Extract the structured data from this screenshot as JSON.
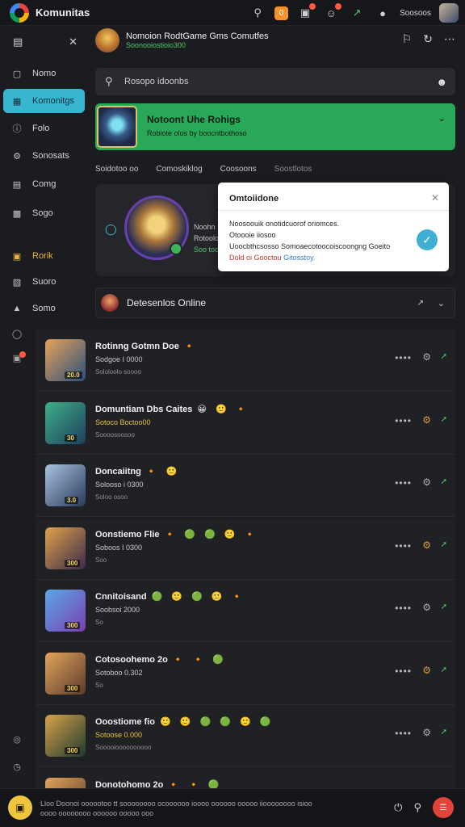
{
  "app": {
    "title": "Komunitas"
  },
  "topbar": {
    "icons": [
      "search-icon",
      "notification-icon",
      "gift-icon",
      "emoji-icon",
      "activity-icon"
    ],
    "notification_count": "0",
    "user_name": "Soosoos"
  },
  "sidebar": {
    "header_icon": "layout-icon",
    "close_icon": "close-icon",
    "items": [
      {
        "label": "Nomo",
        "icon": "monitor-icon"
      },
      {
        "label": "Komonitgs",
        "icon": "bookmark-icon"
      },
      {
        "label": "Folo",
        "icon": "info-icon"
      },
      {
        "label": "Sonosats",
        "icon": "settings-icon"
      },
      {
        "label": "Comg",
        "icon": "document-icon"
      },
      {
        "label": "Sogo",
        "icon": "image-icon"
      },
      {
        "label": "Rorik",
        "icon": "calendar-icon"
      },
      {
        "label": "Suoro",
        "icon": "share-icon"
      },
      {
        "label": "Somo",
        "icon": "user-icon"
      }
    ]
  },
  "channel": {
    "title": "Nomoion RodtGame Gms Comutfes",
    "subtitle": "Soonooiostioio300"
  },
  "search": {
    "placeholder": "Rosopo idoonbs"
  },
  "banner": {
    "title": "Notoont Uhe Rohigs",
    "subtitle": "Robiote olos by boocntbothoso"
  },
  "tabs": [
    "Soidotoo oo",
    "Comoskiklog",
    "Coosoons",
    "Soostlotos"
  ],
  "feature": {
    "lines": [
      "Noohn",
      "Rotoolo",
      "Soo too"
    ]
  },
  "popup": {
    "title": "Omtoiidone",
    "line1": "Noosoouik onotidcuorof oriomces.",
    "line2": "Otoooie iiosoo",
    "line3": "Uoocbthcsosso Somoaecotoocoiscoongng Goeito",
    "line4_red": "Dold oi Gooctou",
    "line4_blue": "Gitosstoy."
  },
  "online": {
    "title": "Detesenlos Online"
  },
  "rows": [
    {
      "title": "Rotinng Gotmn Doe",
      "emojis": "🔸",
      "sub": "Sodgoe I 0000",
      "meta": "Sololoolo soooo",
      "level": "20.0",
      "sub_yellow": false,
      "colors": [
        "#e7a25a",
        "#2a4f7a"
      ]
    },
    {
      "title": "Domuntiam Dbs Caites",
      "emojis": "😀 🙂 🔸",
      "sub": "Sotoco Boctoo00",
      "meta": "Soooosoosoo",
      "level": "30",
      "sub_yellow": true,
      "colors": [
        "#3fb08a",
        "#1f3e5c"
      ]
    },
    {
      "title": "Doncaiitng",
      "emojis": "🔸 🙂",
      "sub": "Solooso i 0300",
      "meta": "Soloo osoo",
      "level": "3.0",
      "sub_yellow": false,
      "colors": [
        "#a7c2e0",
        "#2a3a5a"
      ]
    },
    {
      "title": "Oonstiemo Flie",
      "emojis": "🔸 🟢 🟢 🙂 🔸",
      "sub": "Soboos I 0300",
      "meta": "Soo",
      "level": "300",
      "sub_yellow": false,
      "colors": [
        "#e1a24a",
        "#3a2a4a"
      ]
    },
    {
      "title": "Cnnitoisand",
      "emojis": "🟢 🙂 🟢 🙂 🔸",
      "sub": "Soobsoi 2000",
      "meta": "So",
      "level": "300",
      "sub_yellow": false,
      "colors": [
        "#5aa8e8",
        "#7a3fb0"
      ]
    },
    {
      "title": "Cotosoohemo 2o",
      "emojis": "🔸 🔸 🟢",
      "sub": "Sotoboo 0.302",
      "meta": "So",
      "level": "300",
      "sub_yellow": false,
      "colors": [
        "#e2a45c",
        "#5a3a2a"
      ]
    },
    {
      "title": "Ooostiome fio",
      "emojis": "🙂 🙂 🟢 🟢 🙂 🟢",
      "sub": "Sotoose 0.000",
      "meta": "Sooooioooooooooo",
      "level": "300",
      "sub_yellow": true,
      "colors": [
        "#d8a24a",
        "#1e3a2e"
      ]
    },
    {
      "title": "Donotohomo 2o",
      "emojis": "🔸 🔸 🟢",
      "sub": "",
      "meta": "",
      "level": "",
      "sub_yellow": false,
      "colors": [
        "#e2a45c",
        "#5a3a2a"
      ]
    }
  ],
  "bottombar": {
    "text": "Lloo Doonoi oooootoo tt soooooooo ocoooooo ioooo oooooo ooooo iioooooooo isioo oooo oooooooo oooooo ooooo ooo"
  },
  "accent": {
    "teal": "#39b6cf",
    "green": "#2aa85a",
    "red": "#e5433a"
  }
}
